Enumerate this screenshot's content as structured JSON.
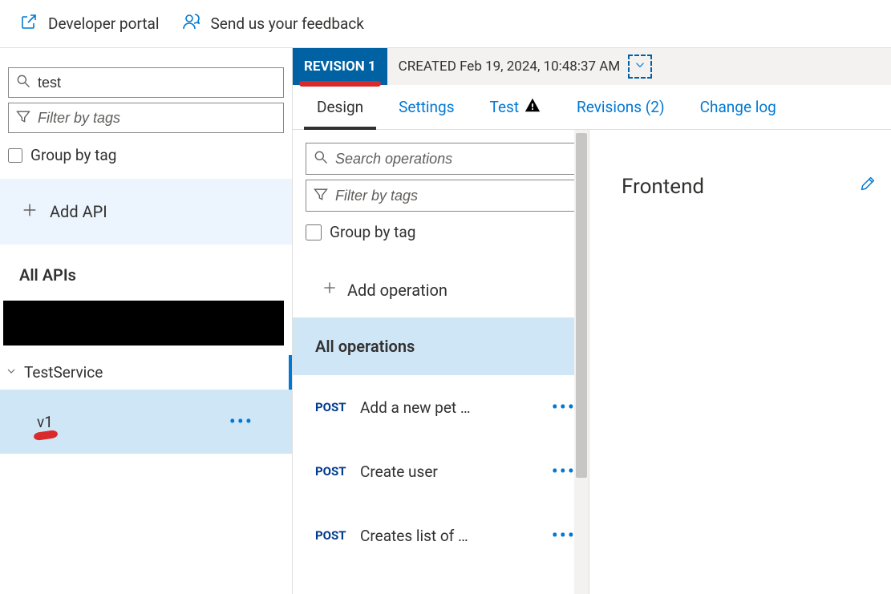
{
  "topbar": {
    "dev_portal": "Developer portal",
    "feedback": "Send us your feedback"
  },
  "sidebar": {
    "search_value": "test",
    "tags_placeholder": "Filter by tags",
    "group_by_tag": "Group by tag",
    "add_api": "Add API",
    "all_apis": "All APIs",
    "api_group": "TestService",
    "api_version": "v1"
  },
  "revision": {
    "badge": "REVISION 1",
    "created_label": "CREATED",
    "created_time": "Feb 19, 2024, 10:48:37 AM"
  },
  "tabs": {
    "design": "Design",
    "settings": "Settings",
    "test": "Test",
    "revisions": "Revisions (2)",
    "changelog": "Change log"
  },
  "ops": {
    "search_placeholder": "Search operations",
    "tags_placeholder": "Filter by tags",
    "group_by_tag": "Group by tag",
    "add_op": "Add operation",
    "all_ops": "All operations",
    "items": [
      {
        "method": "POST",
        "name": "Add a new pet …"
      },
      {
        "method": "POST",
        "name": "Create user"
      },
      {
        "method": "POST",
        "name": "Creates list of …"
      }
    ]
  },
  "frontend": {
    "title": "Frontend"
  }
}
